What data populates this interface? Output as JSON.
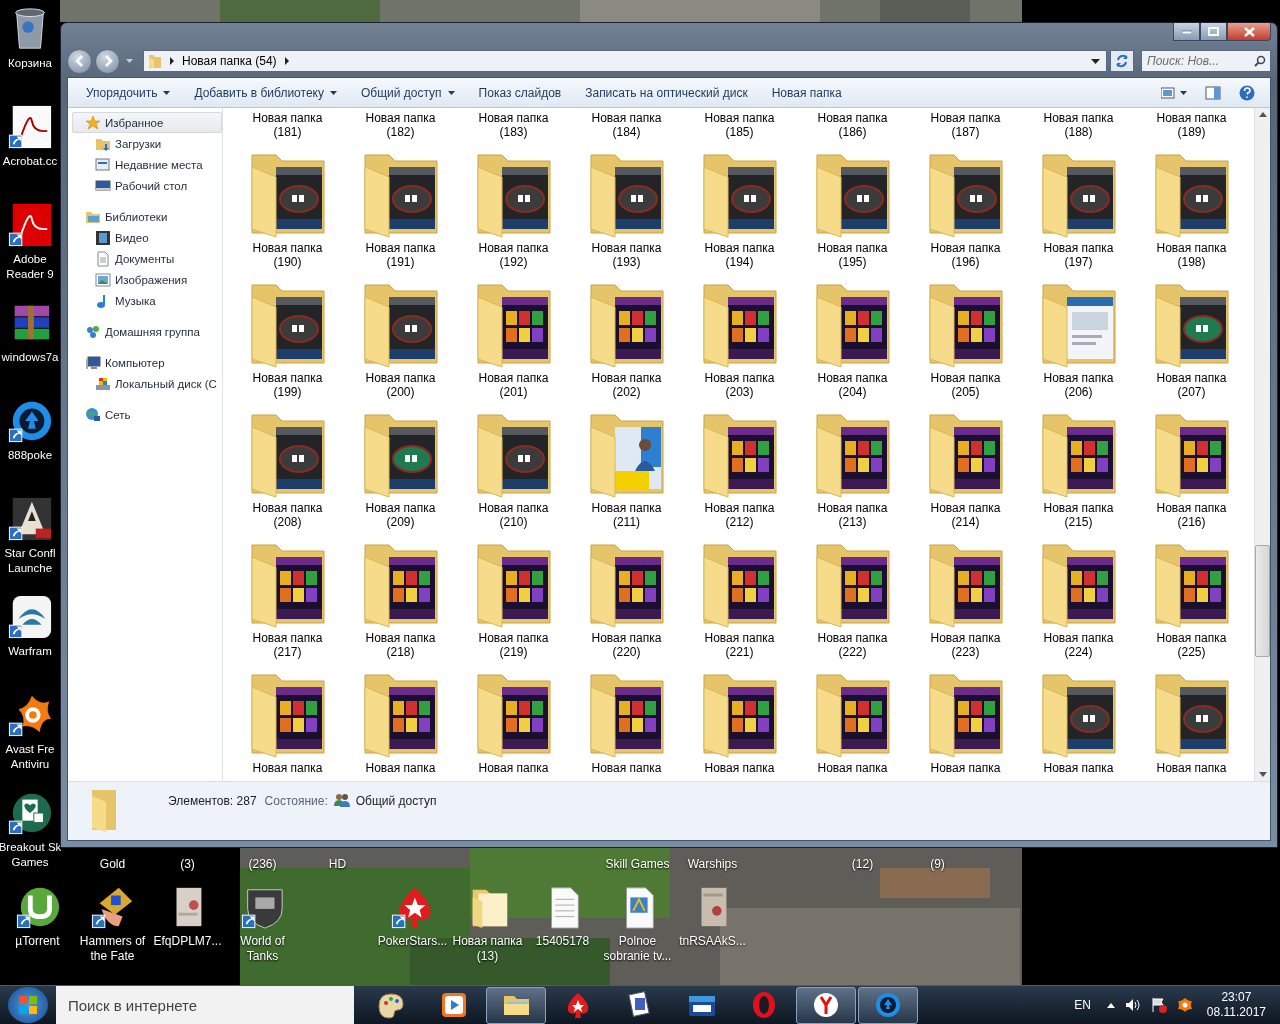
{
  "desktop": {
    "left_icons": [
      {
        "lines": [
          "Корзина"
        ]
      },
      {
        "lines": [
          "Acrobat.cc"
        ]
      },
      {
        "lines": [
          "Adobe",
          "Reader 9"
        ]
      },
      {
        "lines": [
          "windows7a"
        ]
      },
      {
        "lines": [
          "888poke"
        ]
      },
      {
        "lines": [
          "Star Confl",
          "Launche"
        ]
      },
      {
        "lines": [
          "Warfram"
        ]
      },
      {
        "lines": [
          "Avast Fre",
          "Antiviru"
        ]
      },
      {
        "lines": [
          "Breakout Sk",
          "Games"
        ]
      }
    ],
    "partial_labels": [
      "Gold",
      "(3)",
      "(236)",
      "HD",
      "Skill Games",
      "Warships",
      "(12)",
      "(9)"
    ],
    "bottom_icons": [
      {
        "lines": [
          "µTorrent"
        ]
      },
      {
        "lines": [
          "Hammers of",
          "the Fate"
        ]
      },
      {
        "lines": [
          "EfqDPLM7..."
        ]
      },
      {
        "lines": [
          "World of",
          "Tanks"
        ]
      },
      {
        "lines": [
          "PokerStars..."
        ]
      },
      {
        "lines": [
          "Новая папка",
          "(13)"
        ]
      },
      {
        "lines": [
          "15405178"
        ]
      },
      {
        "lines": [
          "Polnoe",
          "sobranie tv..."
        ]
      },
      {
        "lines": [
          "tnRSAAkS..."
        ]
      }
    ]
  },
  "window": {
    "address": {
      "path": "Новая папка (54)"
    },
    "search": {
      "placeholder": "Поиск: Нов..."
    },
    "toolbar": [
      {
        "label": "Упорядочить",
        "menu": true
      },
      {
        "label": "Добавить в библиотеку",
        "menu": true
      },
      {
        "label": "Общий доступ",
        "menu": true
      },
      {
        "label": "Показ слайдов",
        "menu": false
      },
      {
        "label": "Записать на оптический диск",
        "menu": false
      },
      {
        "label": "Новая папка",
        "menu": false
      }
    ],
    "sidebar": {
      "groups": [
        {
          "label": "Избранное",
          "selected": true,
          "children": [
            {
              "label": "Загрузки",
              "selected": false
            },
            {
              "label": "Недавние места",
              "selected": false
            },
            {
              "label": "Рабочий стол",
              "selected": false
            }
          ]
        },
        {
          "label": "Библиотеки",
          "selected": false,
          "children": [
            {
              "label": "Видео",
              "selected": false
            },
            {
              "label": "Документы",
              "selected": false
            },
            {
              "label": "Изображения",
              "selected": false
            },
            {
              "label": "Музыка",
              "selected": false
            }
          ]
        },
        {
          "label": "Домашняя группа",
          "selected": false
        },
        {
          "label": "Компьютер",
          "selected": false,
          "children": [
            {
              "label": "Локальный диск (C",
              "selected": false
            }
          ]
        },
        {
          "label": "Сеть",
          "selected": false
        }
      ]
    },
    "folders": {
      "rows": [
        {
          "icons": false,
          "items": [
            {
              "name": "Новая папка",
              "number": "(181)"
            },
            {
              "name": "Новая папка",
              "number": "(182)"
            },
            {
              "name": "Новая папка",
              "number": "(183)"
            },
            {
              "name": "Новая папка",
              "number": "(184)"
            },
            {
              "name": "Новая папка",
              "number": "(185)"
            },
            {
              "name": "Новая папка",
              "number": "(186)"
            },
            {
              "name": "Новая папка",
              "number": "(187)"
            },
            {
              "name": "Новая папка",
              "number": "(188)"
            },
            {
              "name": "Новая папка",
              "number": "(189)"
            }
          ]
        },
        {
          "icons": true,
          "items": [
            {
              "name": "Новая папка",
              "number": "(190)"
            },
            {
              "name": "Новая папка",
              "number": "(191)"
            },
            {
              "name": "Новая папка",
              "number": "(192)"
            },
            {
              "name": "Новая папка",
              "number": "(193)"
            },
            {
              "name": "Новая папка",
              "number": "(194)"
            },
            {
              "name": "Новая папка",
              "number": "(195)"
            },
            {
              "name": "Новая папка",
              "number": "(196)"
            },
            {
              "name": "Новая папка",
              "number": "(197)"
            },
            {
              "name": "Новая папка",
              "number": "(198)"
            }
          ]
        },
        {
          "icons": true,
          "items": [
            {
              "name": "Новая папка",
              "number": "(199)"
            },
            {
              "name": "Новая папка",
              "number": "(200)"
            },
            {
              "name": "Новая папка",
              "number": "(201)"
            },
            {
              "name": "Новая папка",
              "number": "(202)"
            },
            {
              "name": "Новая папка",
              "number": "(203)"
            },
            {
              "name": "Новая папка",
              "number": "(204)"
            },
            {
              "name": "Новая папка",
              "number": "(205)"
            },
            {
              "name": "Новая папка",
              "number": "(206)"
            },
            {
              "name": "Новая папка",
              "number": "(207)"
            }
          ]
        },
        {
          "icons": true,
          "items": [
            {
              "name": "Новая папка",
              "number": "(208)"
            },
            {
              "name": "Новая папка",
              "number": "(209)"
            },
            {
              "name": "Новая папка",
              "number": "(210)"
            },
            {
              "name": "Новая папка",
              "number": "(211)"
            },
            {
              "name": "Новая папка",
              "number": "(212)"
            },
            {
              "name": "Новая папка",
              "number": "(213)"
            },
            {
              "name": "Новая папка",
              "number": "(214)"
            },
            {
              "name": "Новая папка",
              "number": "(215)"
            },
            {
              "name": "Новая папка",
              "number": "(216)"
            }
          ]
        },
        {
          "icons": true,
          "items": [
            {
              "name": "Новая папка",
              "number": "(217)"
            },
            {
              "name": "Новая папка",
              "number": "(218)"
            },
            {
              "name": "Новая папка",
              "number": "(219)"
            },
            {
              "name": "Новая папка",
              "number": "(220)"
            },
            {
              "name": "Новая папка",
              "number": "(221)"
            },
            {
              "name": "Новая папка",
              "number": "(222)"
            },
            {
              "name": "Новая папка",
              "number": "(223)"
            },
            {
              "name": "Новая папка",
              "number": "(224)"
            },
            {
              "name": "Новая папка",
              "number": "(225)"
            }
          ]
        },
        {
          "icons": true,
          "items": [
            {
              "name": "Новая папка"
            },
            {
              "name": "Новая папка"
            },
            {
              "name": "Новая папка"
            },
            {
              "name": "Новая папка"
            },
            {
              "name": "Новая папка"
            },
            {
              "name": "Новая папка"
            },
            {
              "name": "Новая папка"
            },
            {
              "name": "Новая папка"
            },
            {
              "name": "Новая папка"
            }
          ]
        }
      ]
    },
    "status_bar": {
      "count": "Элементов: 287",
      "state_label": "Состояние:",
      "state": "Общий доступ"
    }
  },
  "taskbar": {
    "search": {
      "placeholder": "Поиск в интернете"
    },
    "apps": [
      {
        "running": false
      },
      {
        "running": false
      },
      {
        "running": true
      },
      {
        "running": false
      },
      {
        "running": false
      },
      {
        "running": false
      },
      {
        "running": false
      },
      {
        "running": true
      },
      {
        "running": true
      }
    ],
    "tray": {
      "language": "EN",
      "time": "23:07",
      "date": "08.11.2017"
    }
  }
}
